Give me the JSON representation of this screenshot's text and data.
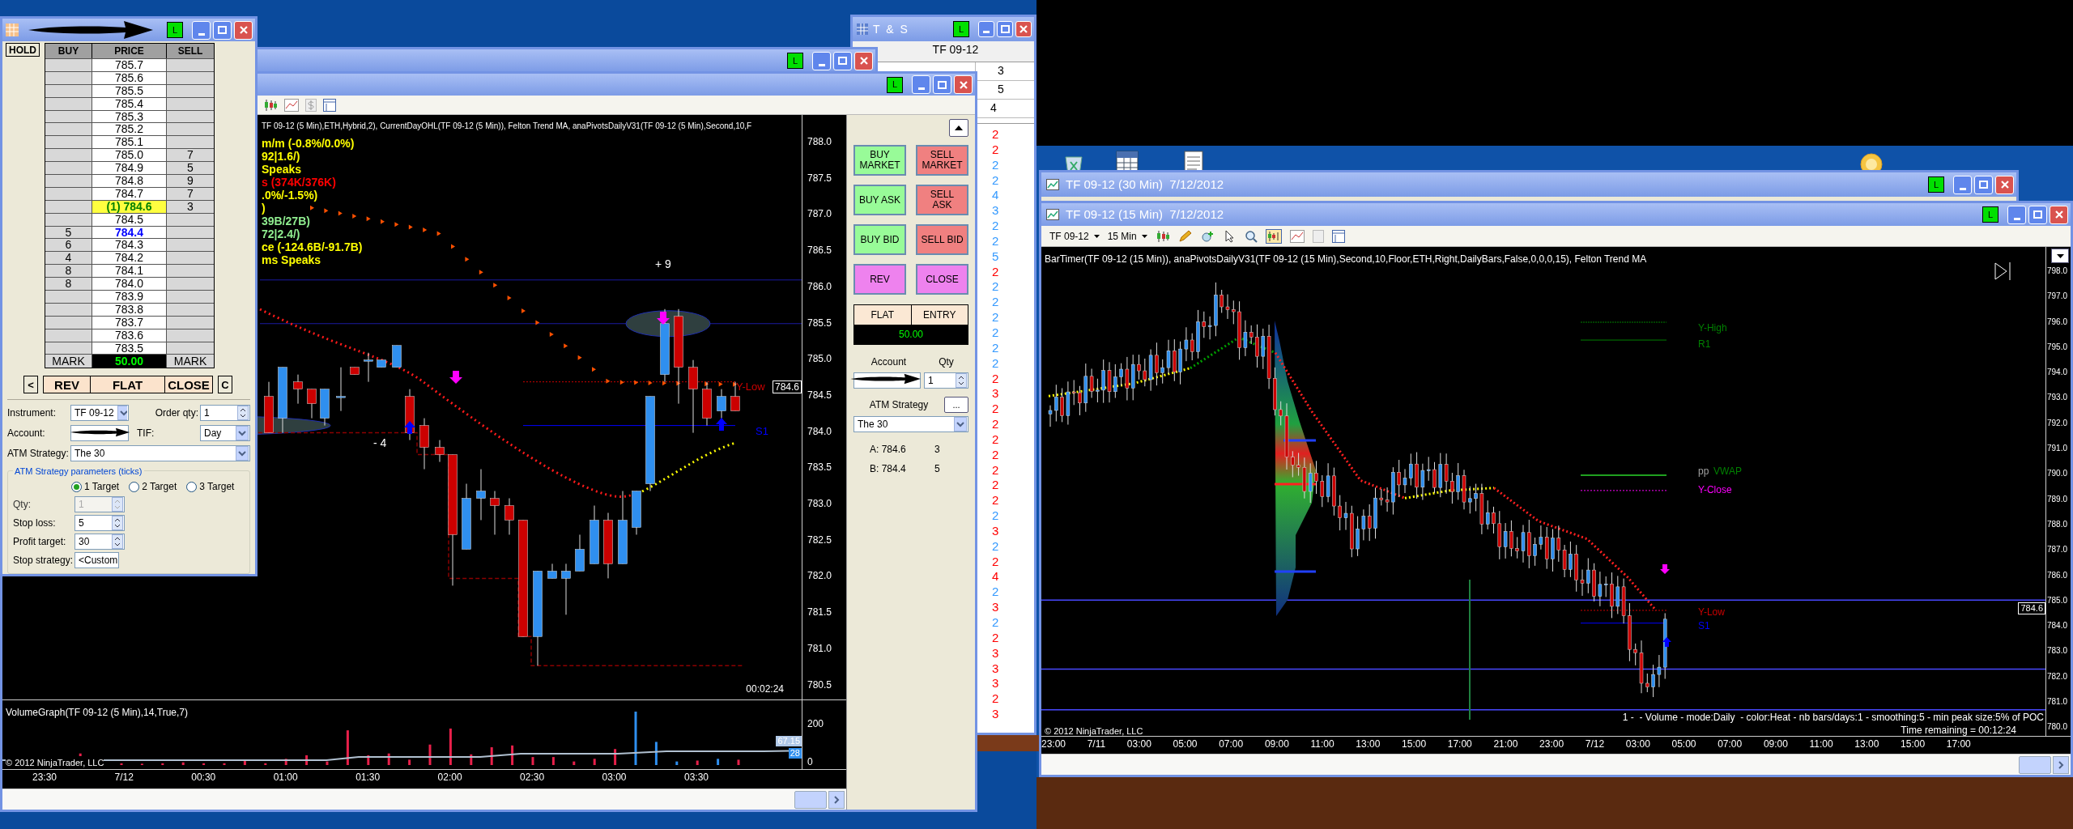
{
  "dom": {
    "badge": "L",
    "hold": "HOLD",
    "columns": [
      "BUY",
      "PRICE",
      "SELL"
    ],
    "rows": [
      {
        "price": "785.7",
        "kind": "plain"
      },
      {
        "price": "785.6",
        "kind": "plain"
      },
      {
        "price": "785.5",
        "kind": "plain"
      },
      {
        "price": "785.4",
        "kind": "plain"
      },
      {
        "price": "785.3",
        "kind": "plain"
      },
      {
        "price": "785.2",
        "kind": "plain"
      },
      {
        "price": "785.1",
        "kind": "plain"
      },
      {
        "price": "785.0",
        "sell": "7",
        "kind": "plain"
      },
      {
        "price": "784.9",
        "sell": "5",
        "kind": "plain"
      },
      {
        "price": "784.8",
        "sell": "9",
        "kind": "plain"
      },
      {
        "price": "784.7",
        "sell": "7",
        "kind": "plain"
      },
      {
        "price": "(1) 784.6",
        "sell": "3",
        "kind": "last"
      },
      {
        "price": "784.5",
        "kind": "plain"
      },
      {
        "buy": "5",
        "price": "784.4",
        "kind": "bid"
      },
      {
        "buy": "6",
        "price": "784.3",
        "kind": "plain"
      },
      {
        "buy": "4",
        "price": "784.2",
        "kind": "plain"
      },
      {
        "buy": "8",
        "price": "784.1",
        "kind": "plain"
      },
      {
        "buy": "8",
        "price": "784.0",
        "kind": "plain"
      },
      {
        "price": "783.9",
        "kind": "plain"
      },
      {
        "price": "783.8",
        "kind": "plain"
      },
      {
        "price": "783.7",
        "kind": "plain"
      },
      {
        "price": "783.6",
        "kind": "plain"
      },
      {
        "price": "783.5",
        "kind": "plain"
      }
    ],
    "mark": {
      "left": "MARK",
      "value": "50.00",
      "right": "MARK"
    },
    "buttons": [
      "<",
      "REV",
      "FLAT",
      "CLOSE",
      "C"
    ],
    "instrument": {
      "label": "Instrument:",
      "value": "TF 09-12"
    },
    "order_qty": {
      "label": "Order qty:",
      "value": "1"
    },
    "account": {
      "label": "Account:"
    },
    "tif": {
      "label": "TIF:",
      "value": "Day"
    },
    "atm_strategy": {
      "label": "ATM Strategy:",
      "value": "The 30"
    },
    "params": {
      "title": "ATM Strategy parameters (ticks)",
      "targets": [
        {
          "label": "1 Target",
          "selected": true
        },
        {
          "label": "2 Target",
          "selected": false
        },
        {
          "label": "3 Target",
          "selected": false
        }
      ],
      "fields": [
        {
          "label": "Qty:",
          "value": "1",
          "disabled": true,
          "kind": "spin"
        },
        {
          "label": "Stop loss:",
          "value": "5",
          "disabled": false,
          "kind": "spin"
        },
        {
          "label": "Profit target:",
          "value": "30",
          "disabled": false,
          "kind": "spin"
        },
        {
          "label": "Stop strategy:",
          "value": "<Custom",
          "disabled": false,
          "kind": "select"
        }
      ]
    }
  },
  "tns": {
    "title": "T & S",
    "badge": "L",
    "instrument": "TF 09-12",
    "cells": [
      "3",
      "5",
      "4"
    ],
    "trades": [
      {
        "size": "2",
        "color": "#ff0000"
      },
      {
        "size": "2",
        "color": "#ff0000"
      },
      {
        "size": "2",
        "color": "#3399ff"
      },
      {
        "size": "2",
        "color": "#3399ff"
      },
      {
        "size": "4",
        "color": "#3399ff"
      },
      {
        "size": "3",
        "color": "#3399ff"
      },
      {
        "size": "2",
        "color": "#3399ff"
      },
      {
        "size": "2",
        "color": "#3399ff"
      },
      {
        "size": "5",
        "color": "#3399ff"
      },
      {
        "size": "2",
        "color": "#ff0000"
      },
      {
        "size": "2",
        "color": "#3399ff"
      },
      {
        "size": "2",
        "color": "#3399ff"
      },
      {
        "size": "2",
        "color": "#3399ff"
      },
      {
        "size": "2",
        "color": "#3399ff"
      },
      {
        "size": "2",
        "color": "#3399ff"
      },
      {
        "size": "2",
        "color": "#3399ff"
      },
      {
        "size": "2",
        "color": "#ff0000"
      },
      {
        "size": "3",
        "color": "#ff0000"
      },
      {
        "size": "2",
        "color": "#ff0000"
      },
      {
        "size": "2",
        "color": "#ff0000"
      },
      {
        "size": "2",
        "color": "#ff0000"
      },
      {
        "size": "2",
        "color": "#ff0000"
      },
      {
        "size": "2",
        "color": "#ff0000"
      },
      {
        "size": "2",
        "color": "#ff0000"
      },
      {
        "size": "2",
        "color": "#ff0000"
      },
      {
        "size": "2",
        "color": "#3399ff"
      },
      {
        "size": "3",
        "color": "#ff0000"
      },
      {
        "size": "2",
        "color": "#3399ff"
      },
      {
        "size": "2",
        "color": "#ff0000"
      },
      {
        "size": "4",
        "color": "#ff0000"
      },
      {
        "size": "2",
        "color": "#3399ff"
      },
      {
        "size": "3",
        "color": "#ff0000"
      },
      {
        "size": "2",
        "color": "#3399ff"
      },
      {
        "size": "2",
        "color": "#ff0000"
      },
      {
        "size": "3",
        "color": "#ff0000"
      },
      {
        "size": "3",
        "color": "#ff0000"
      },
      {
        "size": "3",
        "color": "#ff0000"
      },
      {
        "size": "2",
        "color": "#ff0000"
      },
      {
        "size": "3",
        "color": "#ff0000"
      }
    ]
  },
  "back_chart": {
    "badge": "L"
  },
  "chart5": {
    "badge": "L",
    "indicators": "TF 09-12 (5 Min),ETH,Hybrid,2), CurrentDayOHL(TF 09-12 (5 Min)), Felton Trend MA, anaPivotsDailyV31(TF 09-12 (5 Min),Second,10,F",
    "legend": [
      {
        "text": "m/m (-0.8%/0.0%)",
        "color": "#ffff00"
      },
      {
        "text": "92|1.6/)",
        "color": "#ffff00"
      },
      {
        "text": "Speaks",
        "color": "#ffff00"
      },
      {
        "text": "s (374K/376K)",
        "color": "#ff0000"
      },
      {
        "text": ".0%/-1.5%)",
        "color": "#ffff00"
      },
      {
        "text": ")",
        "color": "#ffff00"
      },
      {
        "text": "39B/27B)",
        "color": "#90ee90"
      },
      {
        "text": "72|2.4/)",
        "color": "#90ee90"
      },
      {
        "text": "ce (-124.6B/-91.7B)",
        "color": "#ffff00"
      },
      {
        "text": "ms Speaks",
        "color": "#ffff00"
      }
    ],
    "y_axis": [
      "788.0",
      "787.5",
      "787.0",
      "786.5",
      "786.0",
      "785.5",
      "785.0",
      "784.5",
      "784.0",
      "783.5",
      "783.0",
      "782.5",
      "782.0",
      "781.5",
      "781.0",
      "780.5"
    ],
    "price_marker": "784.6",
    "trade_labels": [
      "+ 9",
      "- 4"
    ],
    "levels": [
      {
        "text": "Y-Low",
        "color": "#cc0000"
      },
      {
        "text": "S1",
        "color": "#0000ff"
      }
    ],
    "bar_timer": "00:02:24",
    "volume": {
      "title": "VolumeGraph(TF 09-12 (5 Min),14,True,7)",
      "y_axis": [
        "200",
        "0"
      ],
      "markers": [
        "67.15",
        "28"
      ]
    },
    "x_axis": [
      "23:30",
      "7/12",
      "00:30",
      "01:00",
      "01:30",
      "02:00",
      "02:30",
      "03:00",
      "03:30"
    ],
    "copyright": "© 2012 NinjaTrader, LLC",
    "trader": {
      "buttons": [
        {
          "label": "BUY MARKET",
          "kind": "buy"
        },
        {
          "label": "SELL MARKET",
          "kind": "sell"
        },
        {
          "label": "BUY ASK",
          "kind": "buy"
        },
        {
          "label": "SELL ASK",
          "kind": "sell"
        },
        {
          "label": "BUY BID",
          "kind": "buy"
        },
        {
          "label": "SELL BID",
          "kind": "sell"
        },
        {
          "label": "REV",
          "kind": "other"
        },
        {
          "label": "CLOSE",
          "kind": "other"
        }
      ],
      "position": {
        "left": "FLAT",
        "right": "ENTRY",
        "value": "50.00"
      },
      "account_label": "Account",
      "qty_label": "Qty",
      "qty": "1",
      "atm_label": "ATM Strategy",
      "more": "...",
      "atm_value": "The 30",
      "quotes": [
        {
          "label": "A: 784.6",
          "size": "3"
        },
        {
          "label": "B: 784.4",
          "size": "5"
        }
      ]
    }
  },
  "chart30": {
    "title": "TF 09-12 (30 Min)  7/12/2012",
    "badge": "L"
  },
  "chart15": {
    "title": "TF 09-12 (15 Min)  7/12/2012",
    "badge": "L",
    "instrument": "TF 09-12",
    "interval": "15 Min",
    "indicators": "BarTimer(TF 09-12 (15 Min)), anaPivotsDailyV31(TF 09-12 (15 Min),Second,10,Floor,ETH,Right,DailyBars,False,0,0,0,15), Felton Trend MA",
    "y_axis": [
      "798.0",
      "797.0",
      "796.0",
      "795.0",
      "794.0",
      "793.0",
      "792.0",
      "791.0",
      "790.0",
      "789.0",
      "788.0",
      "787.0",
      "786.0",
      "785.0",
      "784.0",
      "783.0",
      "782.0",
      "781.0",
      "780.0"
    ],
    "price_marker": "784.6",
    "levels": [
      {
        "text": "Y-High",
        "color": "#008000"
      },
      {
        "text": "R1",
        "color": "#008000"
      },
      {
        "text": "pp",
        "color": "#a0a0a0"
      },
      {
        "text": "VWAP",
        "color": "#008000"
      },
      {
        "text": "Y-Close",
        "color": "#ff00ff"
      },
      {
        "text": "Y-Low",
        "color": "#cc0000"
      },
      {
        "text": "S1",
        "color": "#0000ff"
      }
    ],
    "profile_info": "1 -  - Volume - mode:Daily  - color:Heat - nb bars/days:1 - smoothing:5 - min peak size:5% of POC",
    "time_remaining": "Time remaining = 00:12:24",
    "copyright": "© 2012 NinjaTrader, LLC",
    "x_axis": [
      "23:00",
      "7/11",
      "03:00",
      "05:00",
      "07:00",
      "09:00",
      "11:00",
      "13:00",
      "15:00",
      "17:00",
      "21:00",
      "23:00",
      "7/12",
      "03:00",
      "05:00",
      "07:00",
      "09:00",
      "11:00",
      "13:00",
      "15:00",
      "17:00"
    ]
  }
}
